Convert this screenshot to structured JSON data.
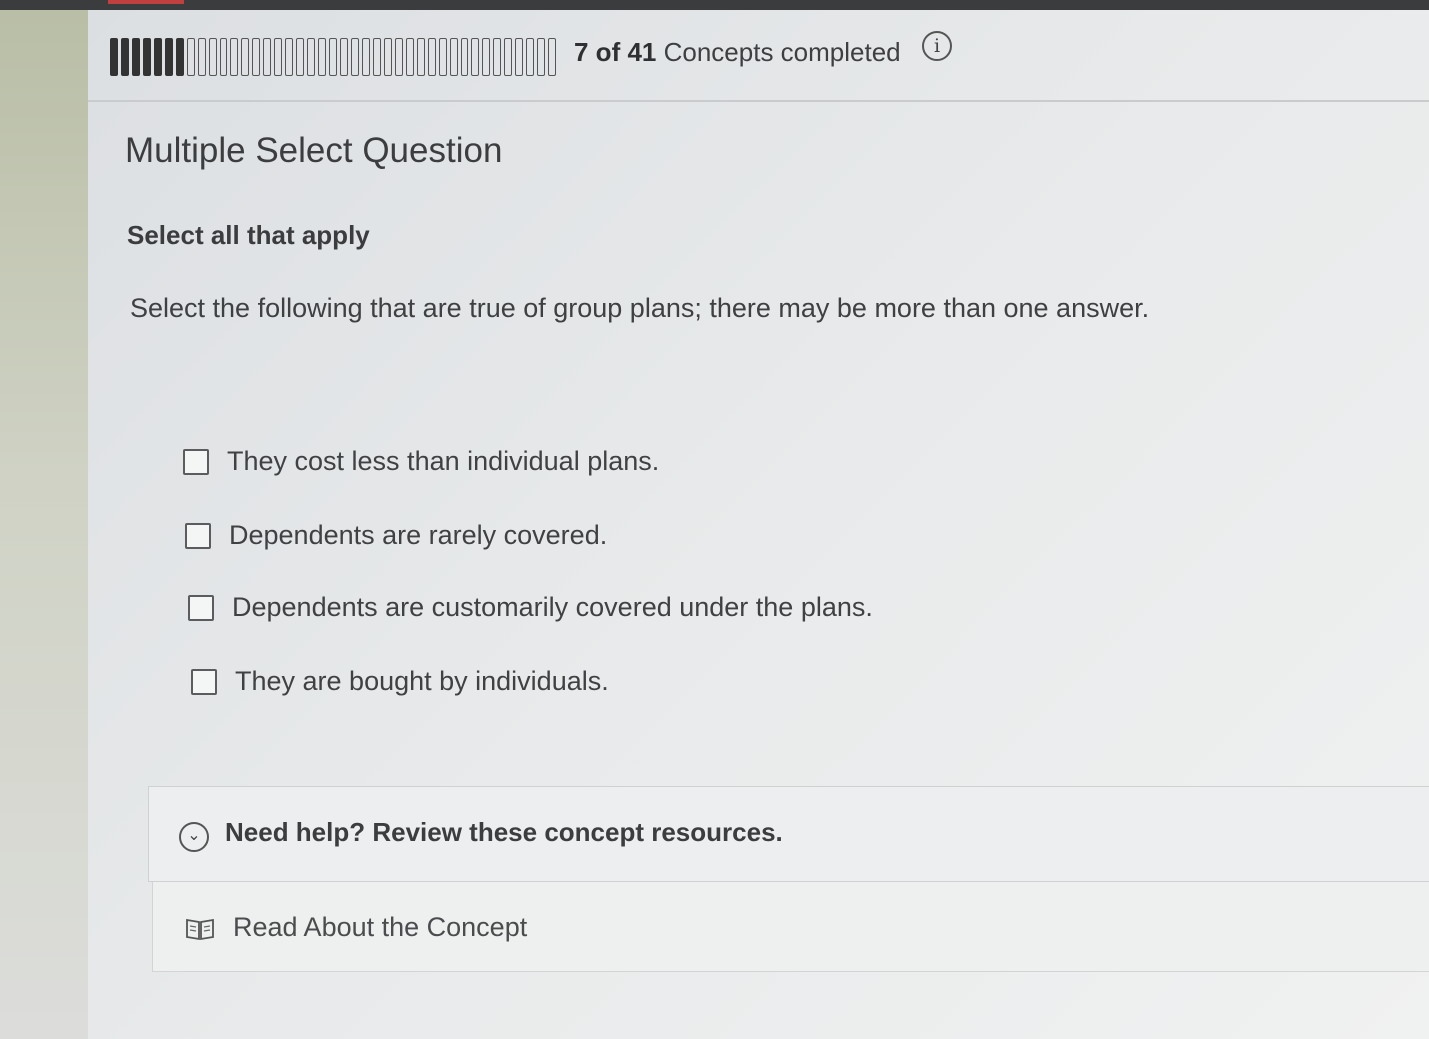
{
  "progress": {
    "completed": 7,
    "total": 41,
    "completed_text": "7 of 41",
    "suffix_text": "Concepts completed"
  },
  "question": {
    "type_label": "Multiple Select Question",
    "instruction": "Select all that apply",
    "prompt": "Select the following that are true of group plans; there may be more than one answer.",
    "options": [
      {
        "label": "They cost less than individual plans.",
        "checked": false
      },
      {
        "label": "Dependents are rarely covered.",
        "checked": false
      },
      {
        "label": "Dependents are customarily covered under the plans.",
        "checked": false
      },
      {
        "label": "They are bought by individuals.",
        "checked": false
      }
    ]
  },
  "help": {
    "toggle_label": "Need help? Review these concept resources.",
    "resource_label": "Read About the Concept"
  },
  "icons": {
    "info": "info-icon",
    "chevron": "chevron-down-icon",
    "book": "book-icon"
  },
  "colors": {
    "progress_filled": "#333333",
    "text": "#3e4042",
    "background": "#e8eaeb"
  }
}
